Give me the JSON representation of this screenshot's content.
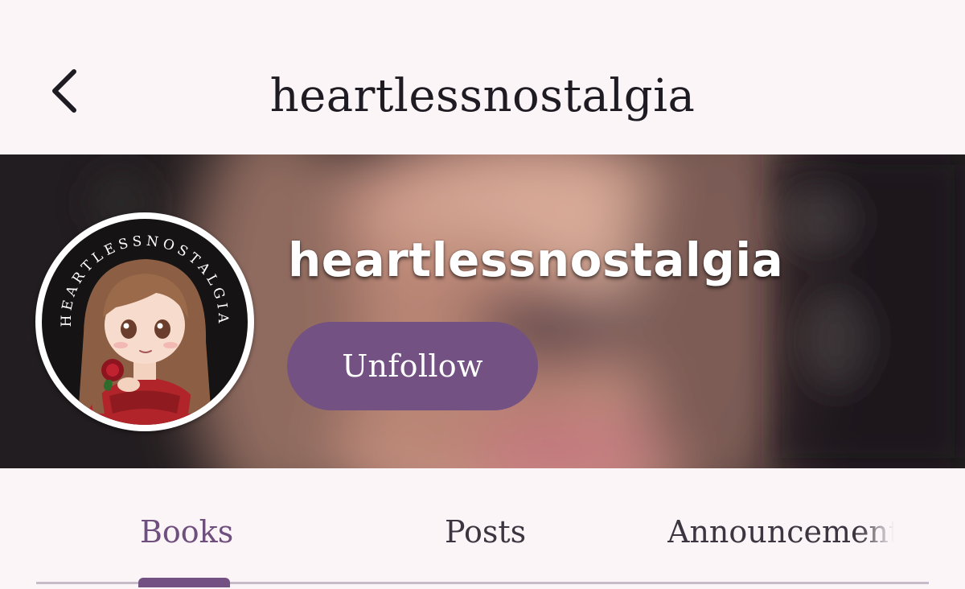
{
  "header": {
    "title": "heartlessnostalgia",
    "back_icon": "chevron-left-icon"
  },
  "profile": {
    "display_name": "heartlessnostalgia",
    "avatar_ring_text": "HEARTLESSNOSTALGIA",
    "follow_button_label": "Unfollow"
  },
  "tabs": [
    {
      "label": "Books",
      "active": true
    },
    {
      "label": "Posts",
      "active": false
    },
    {
      "label": "Announcements",
      "active": false
    }
  ],
  "colors": {
    "accent": "#735183",
    "active_tab_text": "#6e4f7d",
    "background": "#fcf5f8",
    "banner_dark": "#211c1f"
  }
}
